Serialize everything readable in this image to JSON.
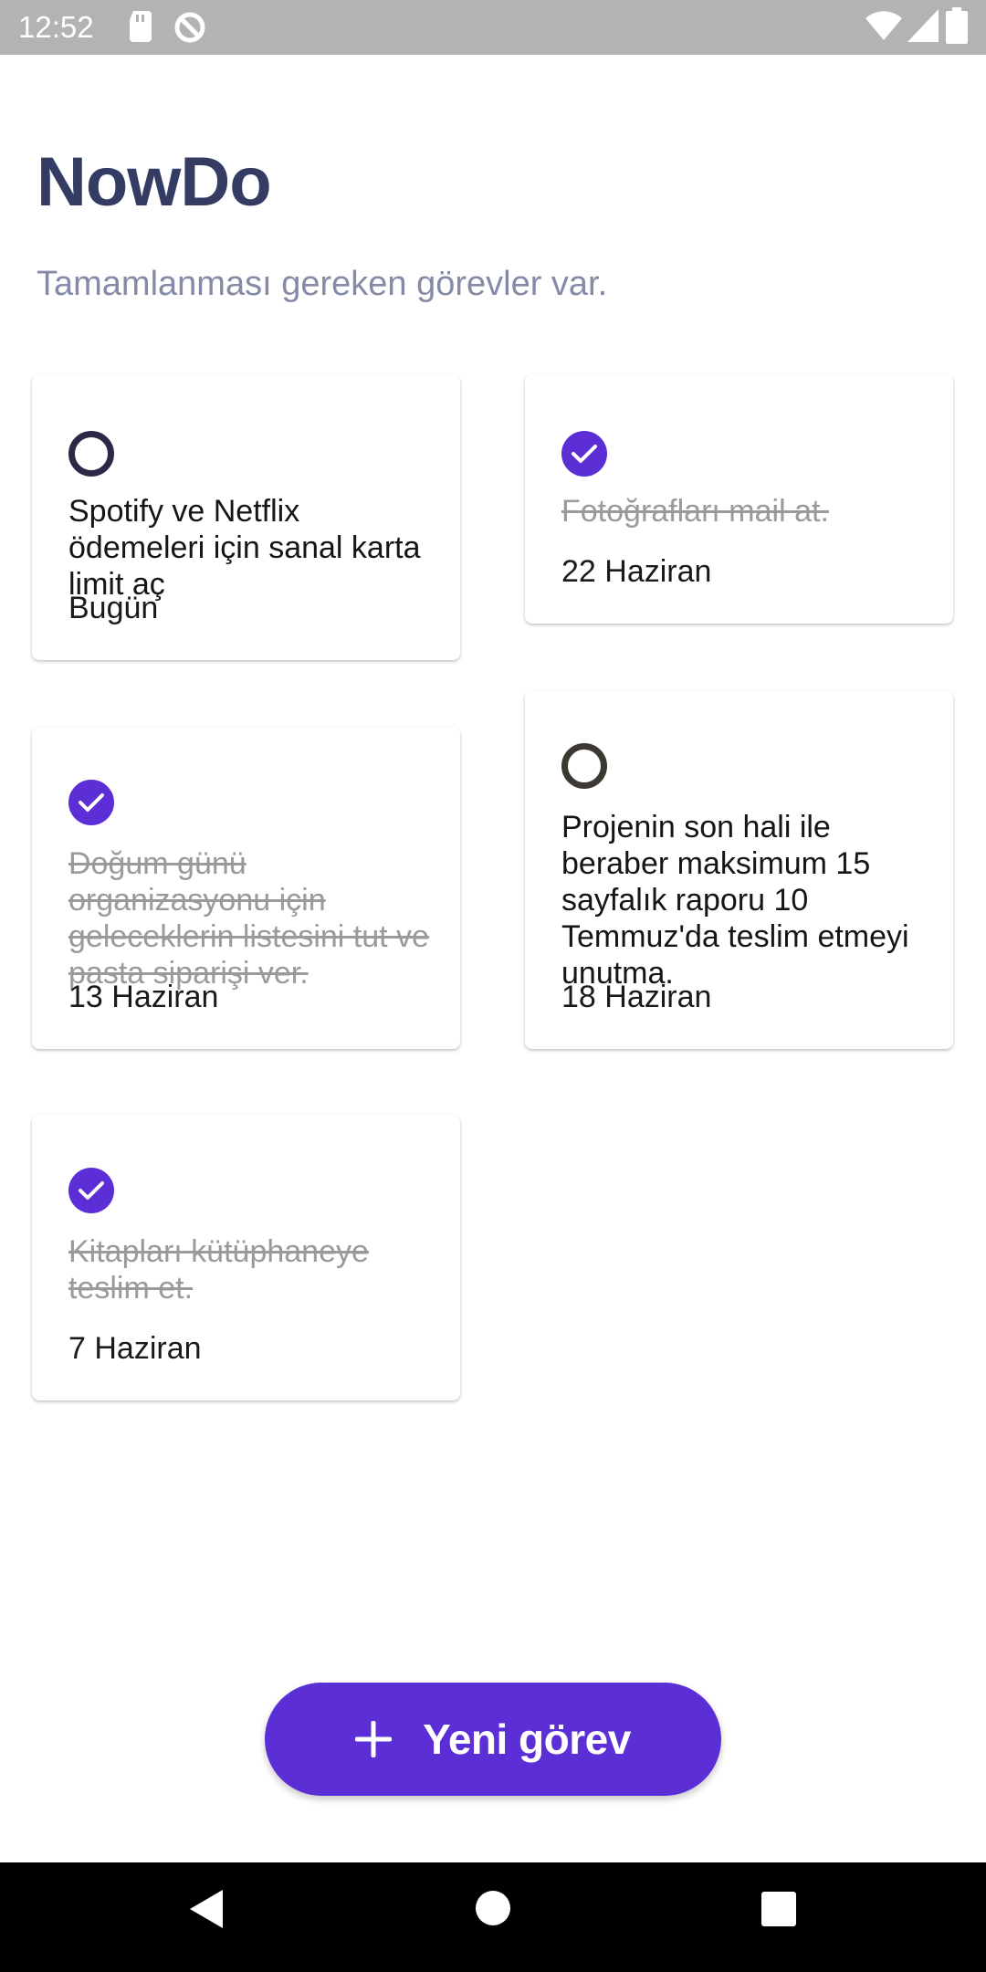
{
  "status_bar": {
    "time": "12:52",
    "icons": [
      "sd-card-icon",
      "sync-icon",
      "wifi-icon",
      "signal-icon",
      "battery-icon"
    ]
  },
  "header": {
    "title": "NowDo",
    "subtitle": "Tamamlanması gereken görevler var."
  },
  "tasks": [
    {
      "text": "Spotify ve Netflix ödemeleri için sanal karta limit aç",
      "date": "Bugün",
      "done": false
    },
    {
      "text": "Fotoğrafları mail at.",
      "date": "22 Haziran",
      "done": true
    },
    {
      "text": "Doğum günü organizasyonu için geleceklerin listesini tut ve pasta siparişi ver.",
      "date": "13 Haziran",
      "done": true
    },
    {
      "text": "Projenin son hali ile beraber maksimum 15 sayfalık raporu 10 Temmuz'da teslim etmeyi unutma.",
      "date": "18 Haziran",
      "done": false
    },
    {
      "text": "Kitapları kütüphaneye teslim et.",
      "date": "7 Haziran",
      "done": true
    }
  ],
  "fab": {
    "label": "Yeni görev",
    "icon": "plus-icon"
  },
  "nav_bar": {
    "buttons": [
      "back-icon",
      "home-icon",
      "recents-icon"
    ]
  },
  "colors": {
    "accent": "#5b2ed6",
    "title": "#343c64",
    "subtitle": "#858aa6",
    "done_text": "#9a9a9a"
  }
}
